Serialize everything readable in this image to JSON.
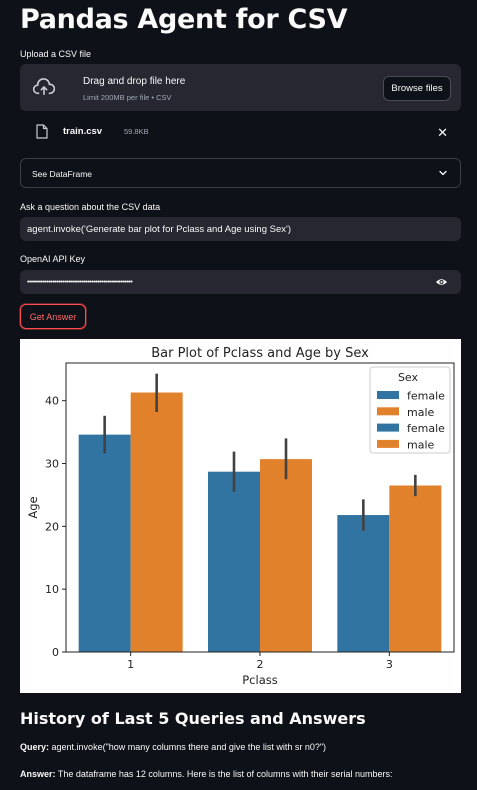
{
  "app": {
    "title": "Pandas Agent for CSV"
  },
  "uploader": {
    "label": "Upload a CSV file",
    "drag_text": "Drag and drop file here",
    "limit_text": "Limit 200MB per file • CSV",
    "browse_label": "Browse files",
    "file": {
      "name": "train.csv",
      "size": "59.8KB"
    }
  },
  "expander": {
    "label": "See DataFrame"
  },
  "question": {
    "label": "Ask a question about the CSV data",
    "value": "agent.invoke('Generate bar plot for Pclass and Age using Sex')"
  },
  "api_key": {
    "label": "OpenAI API Key",
    "masked_value": "••••••••••••••••••••••••••••••••••••••••••••••••••••••"
  },
  "actions": {
    "get_answer_label": "Get Answer"
  },
  "colors": {
    "female": "#3274a1",
    "male": "#e1812c",
    "accent": "#ff4b4b",
    "background": "#0e1117",
    "input_bg": "#262730"
  },
  "chart_data": {
    "type": "bar",
    "title": "Bar Plot of Pclass and Age by Sex",
    "xlabel": "Pclass",
    "ylabel": "Age",
    "categories": [
      "1",
      "2",
      "3"
    ],
    "ylim": [
      0,
      46
    ],
    "yticks": [
      "0",
      "10",
      "20",
      "30",
      "40"
    ],
    "grid": false,
    "legend": {
      "title": "Sex",
      "placement": "top-right",
      "entries": [
        "female",
        "male",
        "female",
        "male"
      ]
    },
    "series": [
      {
        "name": "female",
        "values": [
          34.6,
          28.7,
          21.8
        ],
        "error": [
          [
            31.6,
            37.6
          ],
          [
            25.5,
            31.9
          ],
          [
            19.3,
            24.3
          ]
        ]
      },
      {
        "name": "male",
        "values": [
          41.3,
          30.7,
          26.5
        ],
        "error": [
          [
            38.2,
            44.3
          ],
          [
            27.5,
            34.0
          ],
          [
            24.8,
            28.2
          ]
        ]
      }
    ]
  },
  "history": {
    "title": "History of Last 5 Queries and Answers",
    "query_label": "Query:",
    "query_text": "agent.invoke(\"how many columns there and give the list with sr n0?\")",
    "answer_label": "Answer:",
    "answer_text": "The dataframe has 12 columns. Here is the list of columns with their serial numbers:"
  }
}
